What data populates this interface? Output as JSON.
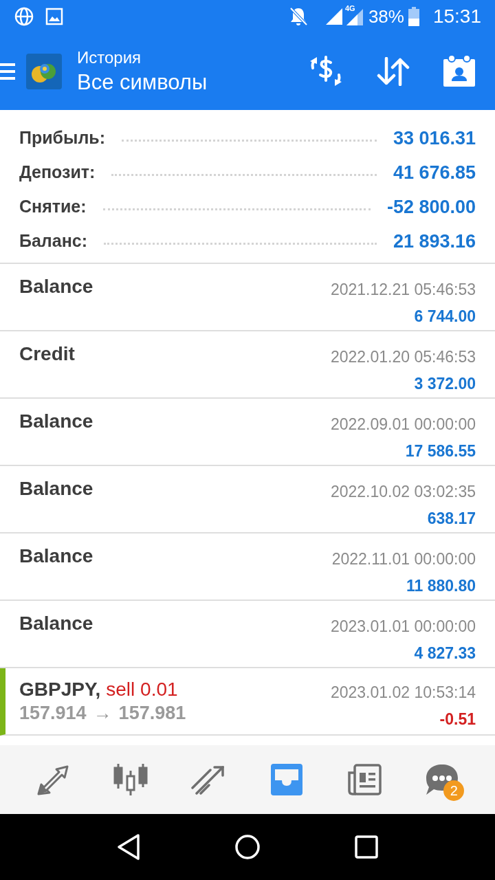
{
  "status_bar": {
    "network": "4G",
    "battery": "38%",
    "time": "15:31"
  },
  "header": {
    "title": "История",
    "subtitle": "Все символы"
  },
  "summary": [
    {
      "label": "Прибыль:",
      "value": "33 016.31"
    },
    {
      "label": "Депозит:",
      "value": "41 676.85"
    },
    {
      "label": "Снятие:",
      "value": "-52 800.00"
    },
    {
      "label": "Баланс:",
      "value": "21 893.16"
    }
  ],
  "operations": [
    {
      "kind": "balance",
      "name": "Balance",
      "time": "2021.12.21 05:46:53",
      "amount": "6 744.00",
      "negative": false
    },
    {
      "kind": "balance",
      "name": "Credit",
      "time": "2022.01.20 05:46:53",
      "amount": "3 372.00",
      "negative": false
    },
    {
      "kind": "balance",
      "name": "Balance",
      "time": "2022.09.01 00:00:00",
      "amount": "17 586.55",
      "negative": false
    },
    {
      "kind": "balance",
      "name": "Balance",
      "time": "2022.10.02 03:02:35",
      "amount": "638.17",
      "negative": false
    },
    {
      "kind": "balance",
      "name": "Balance",
      "time": "2022.11.01 00:00:00",
      "amount": "11 880.80",
      "negative": false
    },
    {
      "kind": "balance",
      "name": "Balance",
      "time": "2023.01.01 00:00:00",
      "amount": "4 827.33",
      "negative": false
    },
    {
      "kind": "trade",
      "name": "GBPJPY,",
      "action": "sell 0.01",
      "open_price": "157.914",
      "arrow": "→",
      "close_price": "157.981",
      "time": "2023.01.02 10:53:14",
      "amount": "-0.51",
      "negative": true
    }
  ],
  "bottom_nav": [
    {
      "kind": "quotes",
      "selected": false
    },
    {
      "kind": "chart",
      "selected": false
    },
    {
      "kind": "trade",
      "selected": false
    },
    {
      "kind": "history",
      "selected": true
    },
    {
      "kind": "news",
      "selected": false
    },
    {
      "kind": "chat",
      "selected": false,
      "badge": "2"
    }
  ]
}
